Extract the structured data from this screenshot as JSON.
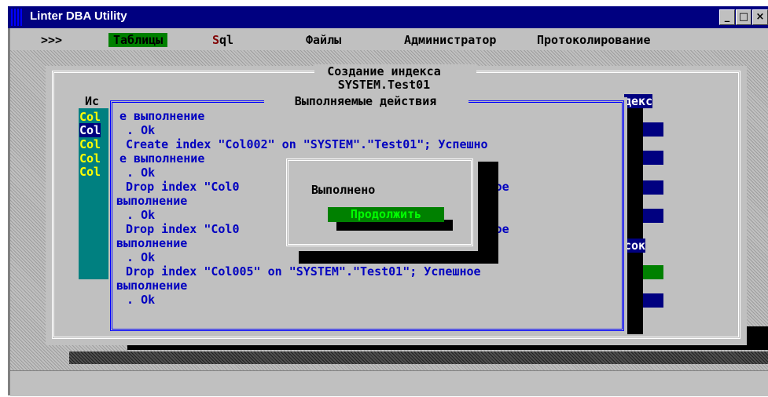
{
  "window": {
    "title": "Linter DBA Utility"
  },
  "menu": {
    "items": [
      {
        "label": ">>>"
      },
      {
        "label": "Таблицы"
      },
      {
        "label_first": "S",
        "label_rest": "ql"
      },
      {
        "label": "Файлы"
      },
      {
        "label": "Администратор"
      },
      {
        "label": "Протоколирование"
      }
    ]
  },
  "index_dialog": {
    "title_line1": "Создание индекса",
    "title_line2": "SYSTEM.Test01",
    "left_header": "Ис",
    "columns": [
      "Col",
      "Col",
      "Col",
      "Col",
      "Col"
    ],
    "right_header": "декс",
    "right_list_label": "сок"
  },
  "actions": {
    "title": "Выполняемые действия",
    "lines": [
      "е выполнение",
      " . Ok",
      "Create index \"Col002\" on \"SYSTEM\".\"Test01\"; Успешно",
      "е выполнение",
      " . Ok",
      "Drop index \"Col0                         01\"; Успешное",
      "выполнение",
      " . Ok",
      "Drop index \"Col0                         01\"; Успешное",
      "выполнение",
      " . Ok",
      "Drop index \"Col005\" on \"SYSTEM\".\"Test01\"; Успешное",
      "выполнение",
      " . Ok"
    ]
  },
  "modal": {
    "message": "Выполнено",
    "continue_label": "Продолжить"
  }
}
